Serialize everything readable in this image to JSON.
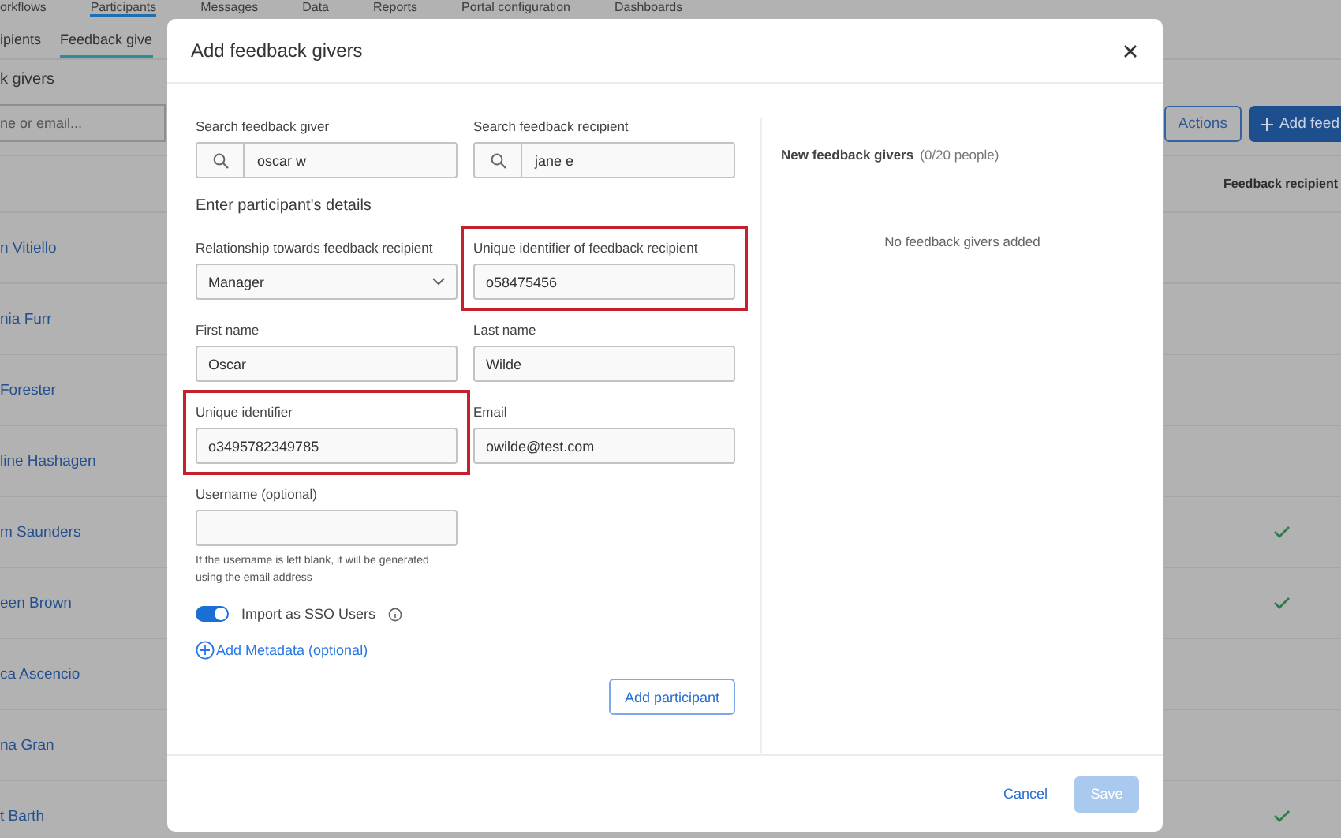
{
  "nav_tabs": [
    {
      "label": "orkflows",
      "selected": false
    },
    {
      "label": "Participants",
      "selected": true
    },
    {
      "label": "Messages",
      "selected": false
    },
    {
      "label": "Data",
      "selected": false
    },
    {
      "label": "Reports",
      "selected": false
    },
    {
      "label": "Portal configuration",
      "selected": false
    },
    {
      "label": "Dashboards",
      "selected": false
    }
  ],
  "sub_tabs": [
    {
      "label": "ipients",
      "selected": false
    },
    {
      "label": "Feedback give",
      "selected": true
    }
  ],
  "section_title": "k givers",
  "search": {
    "placeholder": "ne or email..."
  },
  "toolbar": {
    "actions": "Actions",
    "add": "Add feed"
  },
  "table": {
    "columns": [
      "Feedback recipient"
    ],
    "rows": [
      {
        "name": "n Vitiello",
        "checked": false
      },
      {
        "name": "nia Furr",
        "checked": false
      },
      {
        "name": "Forester",
        "checked": false
      },
      {
        "name": "line Hashagen",
        "checked": false
      },
      {
        "name": "m Saunders",
        "checked": true
      },
      {
        "name": "een Brown",
        "checked": true
      },
      {
        "name": "ca Ascencio",
        "checked": false
      },
      {
        "name": "na Gran",
        "checked": false
      },
      {
        "name": "t Barth",
        "checked": true
      }
    ]
  },
  "dialog": {
    "title": "Add feedback givers",
    "fields": [
      {
        "kind": "search",
        "label": "Search feedback giver",
        "value": "oscar w",
        "highlighted": false
      },
      {
        "kind": "search",
        "label": "Search feedback recipient",
        "value": "jane e",
        "highlighted": false
      },
      {
        "kind": "heading",
        "label": "Enter participant's details"
      },
      {
        "kind": "select",
        "label": "Relationship towards feedback recipient",
        "value": "Manager",
        "highlighted": false
      },
      {
        "kind": "text",
        "label": "Unique identifier of feedback recipient",
        "value": "o58475456",
        "highlighted": true
      },
      {
        "kind": "text",
        "label": "First name",
        "value": "Oscar",
        "highlighted": false
      },
      {
        "kind": "text",
        "label": "Last name",
        "value": "Wilde",
        "highlighted": false
      },
      {
        "kind": "text",
        "label": "Unique identifier",
        "value": "o3495782349785",
        "highlighted": true
      },
      {
        "kind": "text",
        "label": "Email",
        "value": "owilde@test.com",
        "highlighted": false
      },
      {
        "kind": "text",
        "label": "Username (optional)",
        "hint": "If the username is left blank, it will be generated using the email address",
        "highlighted": false
      }
    ],
    "sso_toggle": {
      "label": "Import as SSO Users",
      "on": true
    },
    "metadata_link": "Add Metadata (optional)",
    "add_button": "Add participant",
    "panel": {
      "title": "New feedback givers",
      "count": "(0/20 people)",
      "empty": "No feedback givers added"
    },
    "cancel": "Cancel",
    "save": {
      "label": "Save",
      "disabled": true
    }
  }
}
